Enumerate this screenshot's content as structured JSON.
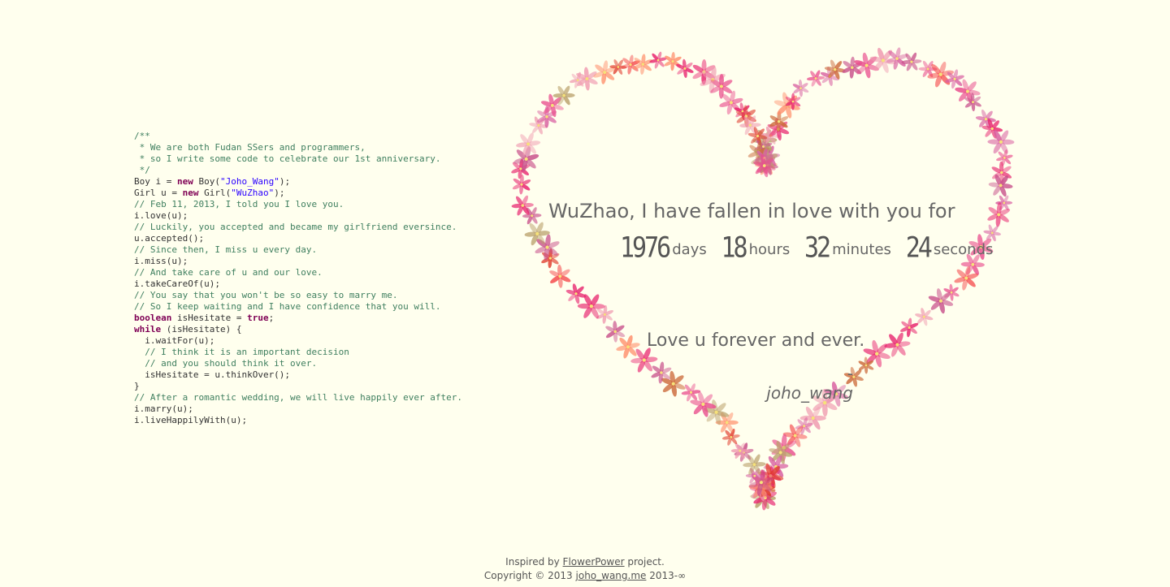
{
  "code_lines": [
    [
      {
        "t": "/**",
        "c": "cm"
      }
    ],
    [
      {
        "t": " * We are both Fudan SSers and programmers,",
        "c": "cm"
      }
    ],
    [
      {
        "t": " * so I write some code to celebrate our 1st anniversary.",
        "c": "cm"
      }
    ],
    [
      {
        "t": " */",
        "c": "cm"
      }
    ],
    [
      {
        "t": "Boy i = "
      },
      {
        "t": "new",
        "c": "kw"
      },
      {
        "t": " Boy("
      },
      {
        "t": "\"Joho_Wang\"",
        "c": "st"
      },
      {
        "t": ");"
      }
    ],
    [
      {
        "t": "Girl u = "
      },
      {
        "t": "new",
        "c": "kw"
      },
      {
        "t": " Girl("
      },
      {
        "t": "\"WuZhao\"",
        "c": "st"
      },
      {
        "t": ");"
      }
    ],
    [
      {
        "t": "// Feb 11, 2013, I told you I love you.",
        "c": "cm"
      }
    ],
    [
      {
        "t": "i.love(u);"
      }
    ],
    [
      {
        "t": "// Luckily, you accepted and became my girlfriend eversince.",
        "c": "cm"
      }
    ],
    [
      {
        "t": "u.accepted();"
      }
    ],
    [
      {
        "t": "// Since then, I miss u every day.",
        "c": "cm"
      }
    ],
    [
      {
        "t": "i.miss(u);"
      }
    ],
    [
      {
        "t": "// And take care of u and our love.",
        "c": "cm"
      }
    ],
    [
      {
        "t": "i.takeCareOf(u);"
      }
    ],
    [
      {
        "t": "// You say that you won't be so easy to marry me.",
        "c": "cm"
      }
    ],
    [
      {
        "t": "// So I keep waiting and I have confidence that you will.",
        "c": "cm"
      }
    ],
    [
      {
        "t": "boolean",
        "c": "kw"
      },
      {
        "t": " isHesitate = "
      },
      {
        "t": "true",
        "c": "kw"
      },
      {
        "t": ";"
      }
    ],
    [
      {
        "t": "while",
        "c": "kw"
      },
      {
        "t": " (isHesitate) {"
      }
    ],
    [
      {
        "t": "  i.waitFor(u);"
      }
    ],
    [
      {
        "t": "  // I think it is an important decision",
        "c": "cm"
      }
    ],
    [
      {
        "t": "  // and you should think it over.",
        "c": "cm"
      }
    ],
    [
      {
        "t": "  isHesitate = u.thinkOver();"
      }
    ],
    [
      {
        "t": "}"
      }
    ],
    [
      {
        "t": "// After a romantic wedding, we will live happily ever after.",
        "c": "cm"
      }
    ],
    [
      {
        "t": "i.marry(u);"
      }
    ],
    [
      {
        "t": "i.liveHappilyWith(u);"
      }
    ]
  ],
  "message": {
    "line": "WuZhao, I have fallen in love with you for",
    "days": "1976",
    "days_label": "days",
    "hours": "18",
    "hours_label": "hours",
    "minutes": "32",
    "minutes_label": "minutes",
    "seconds": "24",
    "seconds_label": "seconds"
  },
  "love_u": "Love u forever and ever.",
  "author": "- joho_wang",
  "footer": {
    "inspired_prefix": "Inspired by ",
    "flowerpower_link": "FlowerPower",
    "inspired_suffix": " project.",
    "copyright_prefix": "Copyright © 2013 ",
    "site_link": "joho_wang.me",
    "copyright_suffix": " 2013-∞"
  },
  "colors": {
    "background": "#ffffee",
    "flowers": [
      "#e8246e",
      "#f5484a",
      "#ff8f6b",
      "#d85fa0",
      "#e94c8c",
      "#cc6a3a",
      "#b9a06a",
      "#f09bb0",
      "#e03a2a",
      "#c8508a"
    ]
  }
}
